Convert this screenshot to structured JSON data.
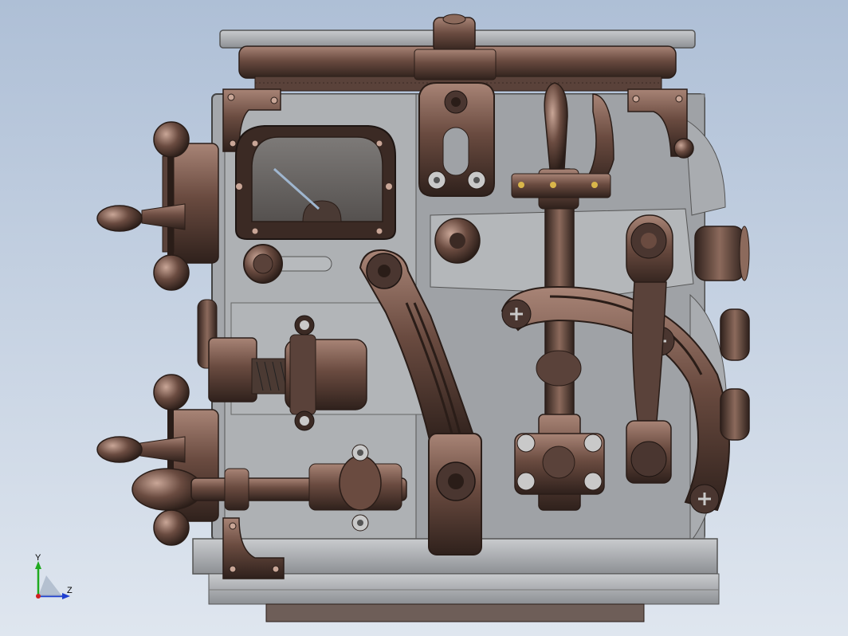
{
  "viewport": {
    "background_top": "#aebfd6",
    "background_bottom": "#dfe6ef"
  },
  "model": {
    "body_color": "#9a9da1",
    "body_light": "#b9bcbf",
    "bronze_dark": "#3b2a24",
    "bronze_mid": "#6a4b40",
    "bronze_light": "#a88476"
  },
  "axis_triad": {
    "y_label": "Y",
    "z_label": "Z",
    "y_color": "#1faa1f",
    "z_color": "#1f3fd0",
    "origin_color": "#d01f1f"
  }
}
